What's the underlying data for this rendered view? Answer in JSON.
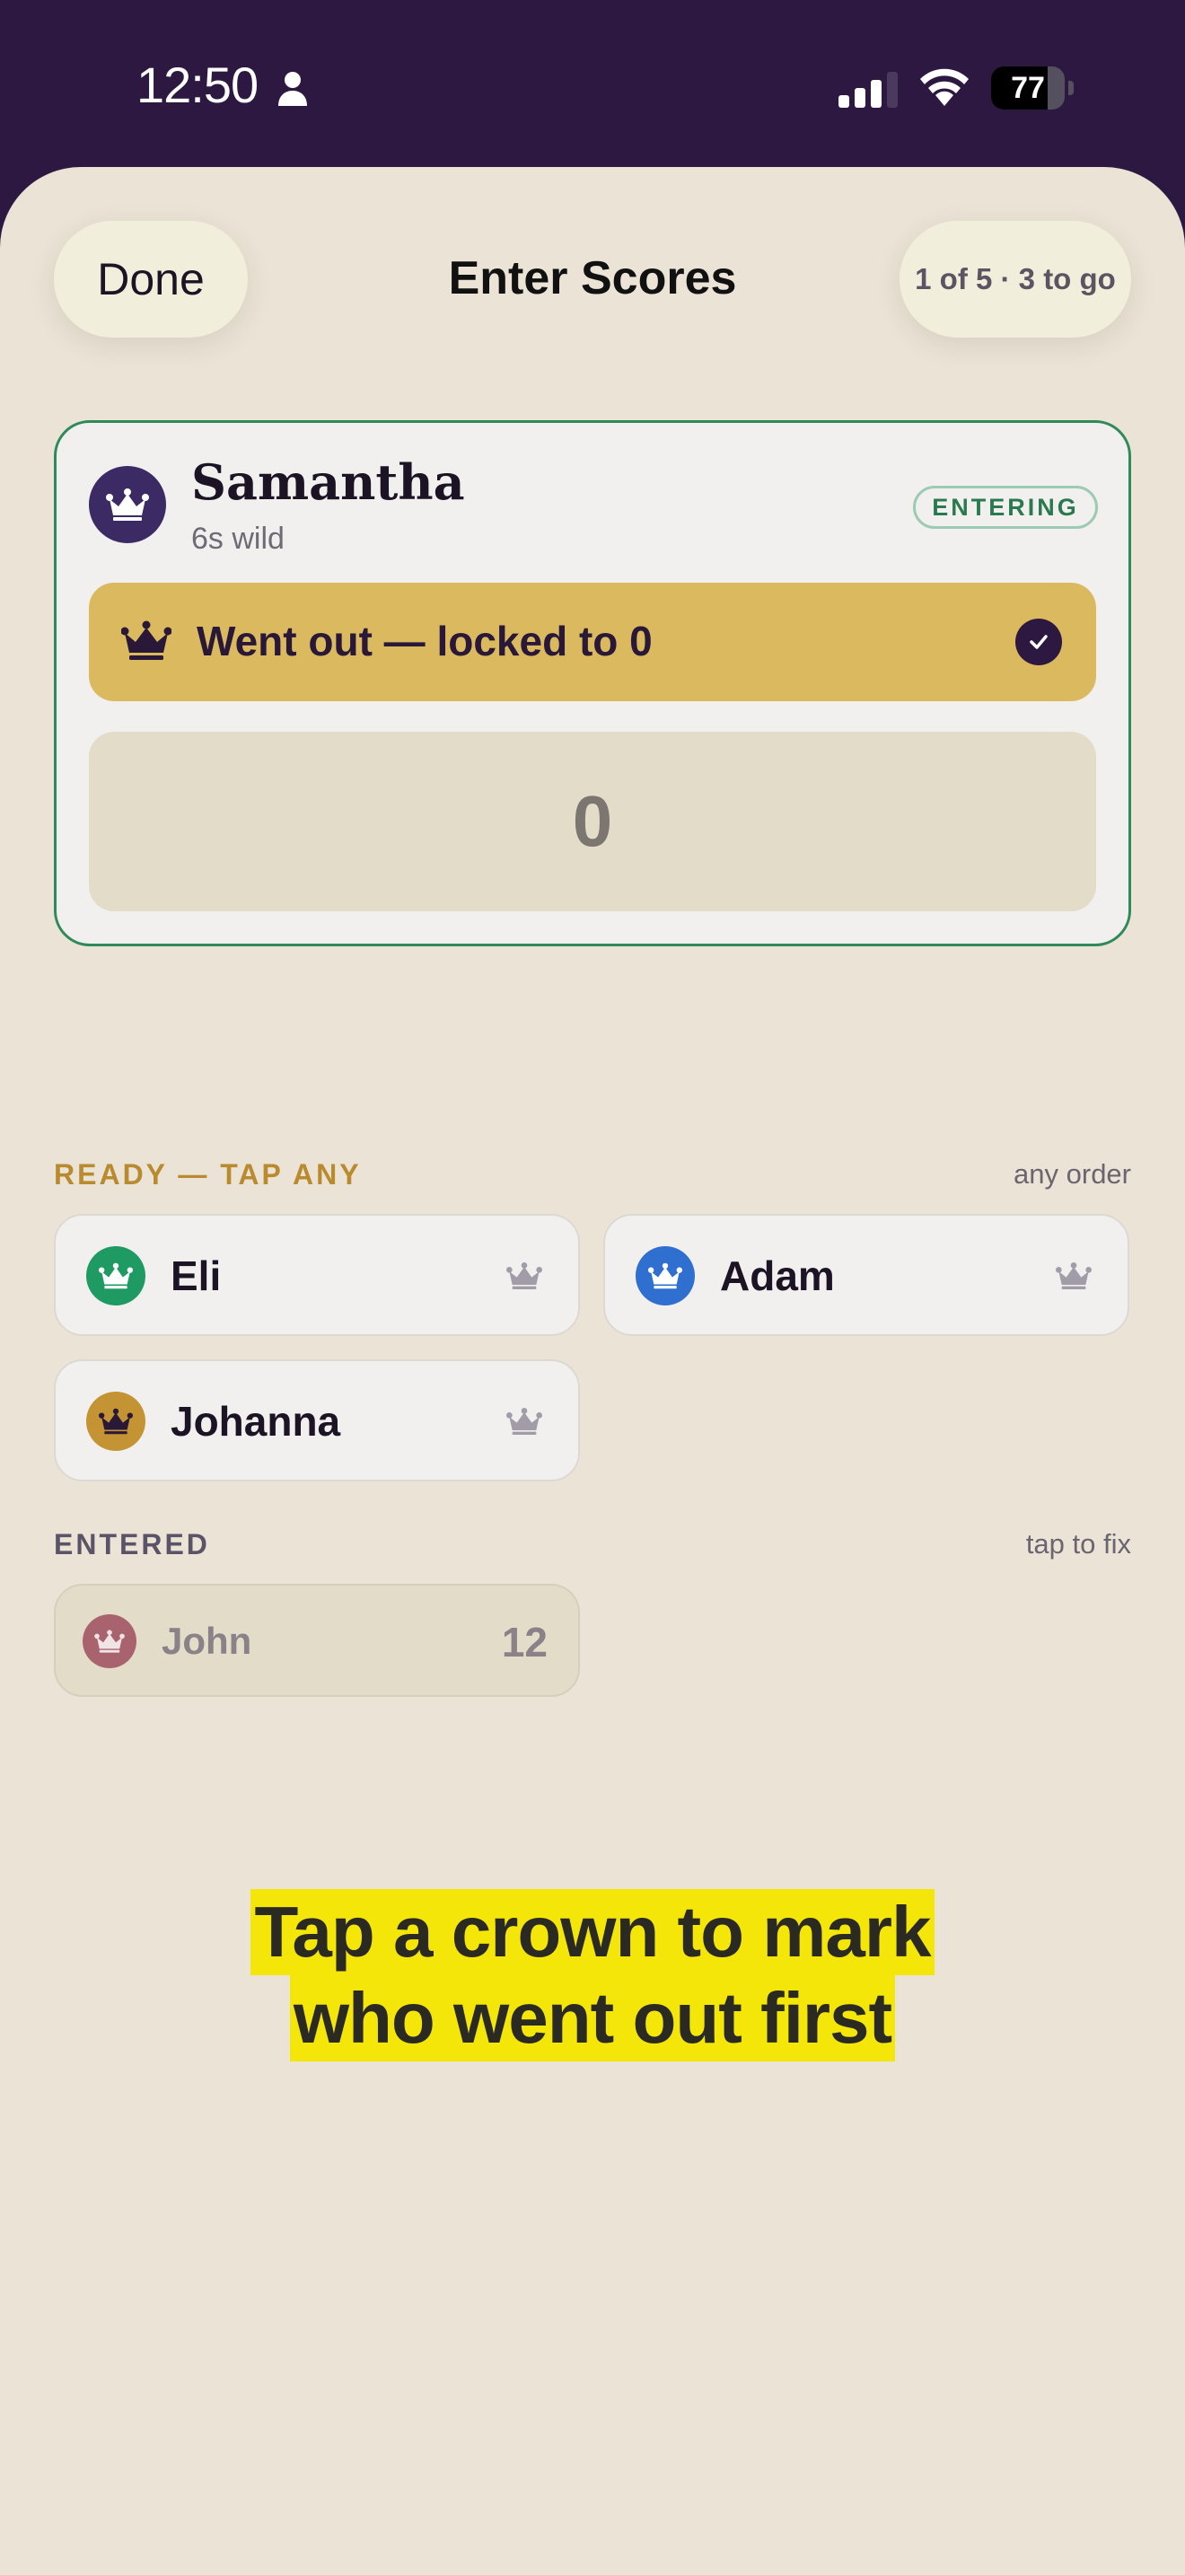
{
  "status_bar": {
    "time": "12:50",
    "battery": "77",
    "battery_level_percent": 77,
    "icons": [
      "person-icon",
      "cellular-signal-icon",
      "wifi-icon",
      "battery-icon"
    ]
  },
  "header": {
    "done_label": "Done",
    "title": "Enter Scores",
    "progress": "1 of 5 · 3 to go"
  },
  "active_player": {
    "name": "Samantha",
    "subtitle": "6s wild",
    "badge": "ENTERING",
    "went_out_label": "Went out — locked to 0",
    "score": "0",
    "avatar_color": "#3b2a64"
  },
  "ready_section": {
    "label": "READY — TAP ANY",
    "hint": "any order",
    "players": [
      {
        "name": "Eli",
        "avatar_color": "#1f9a63"
      },
      {
        "name": "Adam",
        "avatar_color": "#2f6fd0"
      },
      {
        "name": "Johanna",
        "avatar_color": "#c49334"
      }
    ]
  },
  "entered_section": {
    "label": "ENTERED",
    "hint": "tap to fix",
    "players": [
      {
        "name": "John",
        "score": "12",
        "avatar_color": "#a04e60"
      }
    ]
  },
  "caption": {
    "line1": "Tap a crown to mark",
    "line2": "who went out first"
  },
  "colors": {
    "background": "#eae3d6",
    "top_bar": "#2c1840",
    "accent_gold": "#dbb95f",
    "accent_green": "#2e8a58",
    "highlight": "#f5e60a"
  }
}
